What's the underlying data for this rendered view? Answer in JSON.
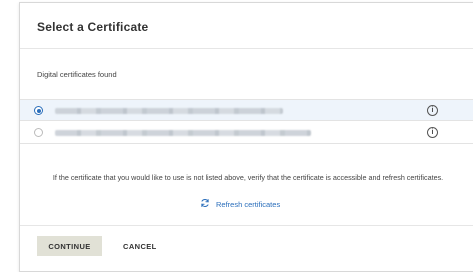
{
  "dialog": {
    "title": "Select a Certificate",
    "subtitle": "Digital certificates found",
    "certificates": [
      {
        "selected": true,
        "info_icon": "info-icon"
      },
      {
        "selected": false,
        "info_icon": "info-icon"
      }
    ],
    "notice": "If the certificate that you would like to use is not listed above, verify that the certificate is accessible and refresh certificates.",
    "refresh_label": "Refresh certificates",
    "refresh_icon": "refresh-icon",
    "continue_label": "CONTINUE",
    "cancel_label": "CANCEL"
  },
  "colors": {
    "accent": "#2a6ebb",
    "selected_row_bg": "#eef4fb",
    "continue_bg": "#e1e1d6"
  }
}
